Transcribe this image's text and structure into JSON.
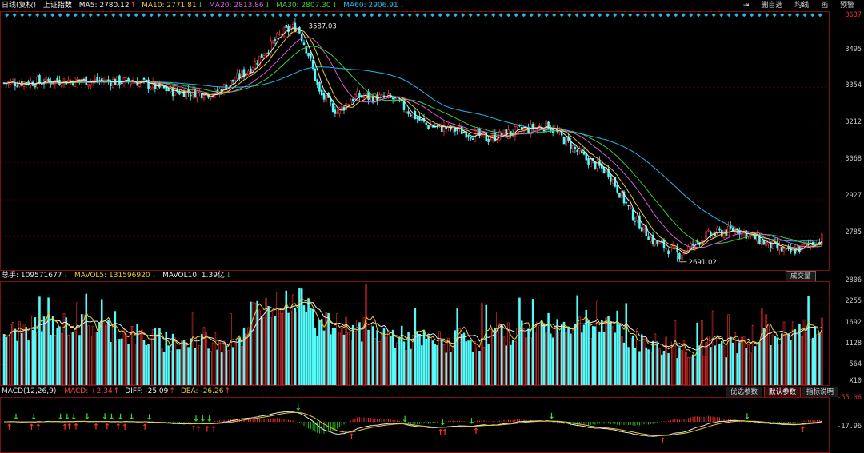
{
  "topbar": {
    "title": "日线(复权)",
    "index_name": "上证指数",
    "ma": [
      {
        "label": "MA5: 2780.12",
        "arrow": "↑",
        "color": "#e8e8e8",
        "arrow_color": "#ff4040"
      },
      {
        "label": "MA10: 2771.81",
        "arrow": "↓",
        "color": "#e8c832",
        "arrow_color": "#40d040"
      },
      {
        "label": "MA20: 2813.86",
        "arrow": "↓",
        "color": "#d65cd6",
        "arrow_color": "#40d040"
      },
      {
        "label": "MA30: 2807.30",
        "arrow": "↓",
        "color": "#3cc83c",
        "arrow_color": "#40d040"
      },
      {
        "label": "MA60: 2906.91",
        "arrow": "↓",
        "color": "#29b6e8",
        "arrow_color": "#40d040"
      }
    ],
    "buttons": {
      "remove_watch": "删自选",
      "average": "均线",
      "mark": "画",
      "warning": "预警"
    }
  },
  "price_axis": {
    "ticks": [
      "3637",
      "3495",
      "3354",
      "3212",
      "3068",
      "2927",
      "2785"
    ],
    "high_label": "3587.03",
    "low_label": "2691.02"
  },
  "volume_strip": {
    "items": [
      {
        "label": "总手: 109571677",
        "arrow": "↓",
        "color": "#e8e8e8",
        "arrow_color": "#40d040"
      },
      {
        "label": "MAVOL5: 131596920",
        "arrow": "↓",
        "color": "#e8c832",
        "arrow_color": "#40d040"
      },
      {
        "label": "MAVOL10: 1.39亿",
        "arrow": "↓",
        "color": "#e8e8e8",
        "arrow_color": "#40d040"
      }
    ],
    "button": "成交量"
  },
  "volume_axis": {
    "ticks": [
      "2806",
      "2255",
      "1692",
      "1128",
      "564"
    ],
    "unit": "X10"
  },
  "macd_strip": {
    "title": "MACD(12,26,9)",
    "items": [
      {
        "label": "MACD: +2.34",
        "arrow": "↑",
        "color": "#ff4040",
        "arrow_color": "#ff4040"
      },
      {
        "label": "DIFF: -25.09",
        "arrow": "↑",
        "color": "#e8e8e8",
        "arrow_color": "#ff4040"
      },
      {
        "label": "DEA: -26.26",
        "arrow": "↑",
        "color": "#e8c832",
        "arrow_color": "#ff4040"
      }
    ],
    "buttons": [
      "优选参数",
      "默认参数",
      "指标说明"
    ]
  },
  "macd_axis": {
    "ticks": [
      "-55.06",
      "-17.96"
    ]
  },
  "colors": {
    "up": "#ff3030",
    "down": "#54fcfc",
    "grid": "#5a0a0a",
    "ma5": "#e8e8e8",
    "ma10": "#e8c832",
    "ma20": "#d65cd6",
    "ma30": "#3cc83c",
    "ma60": "#29b6e8"
  },
  "icons": {
    "exit": "exit-icon"
  }
}
